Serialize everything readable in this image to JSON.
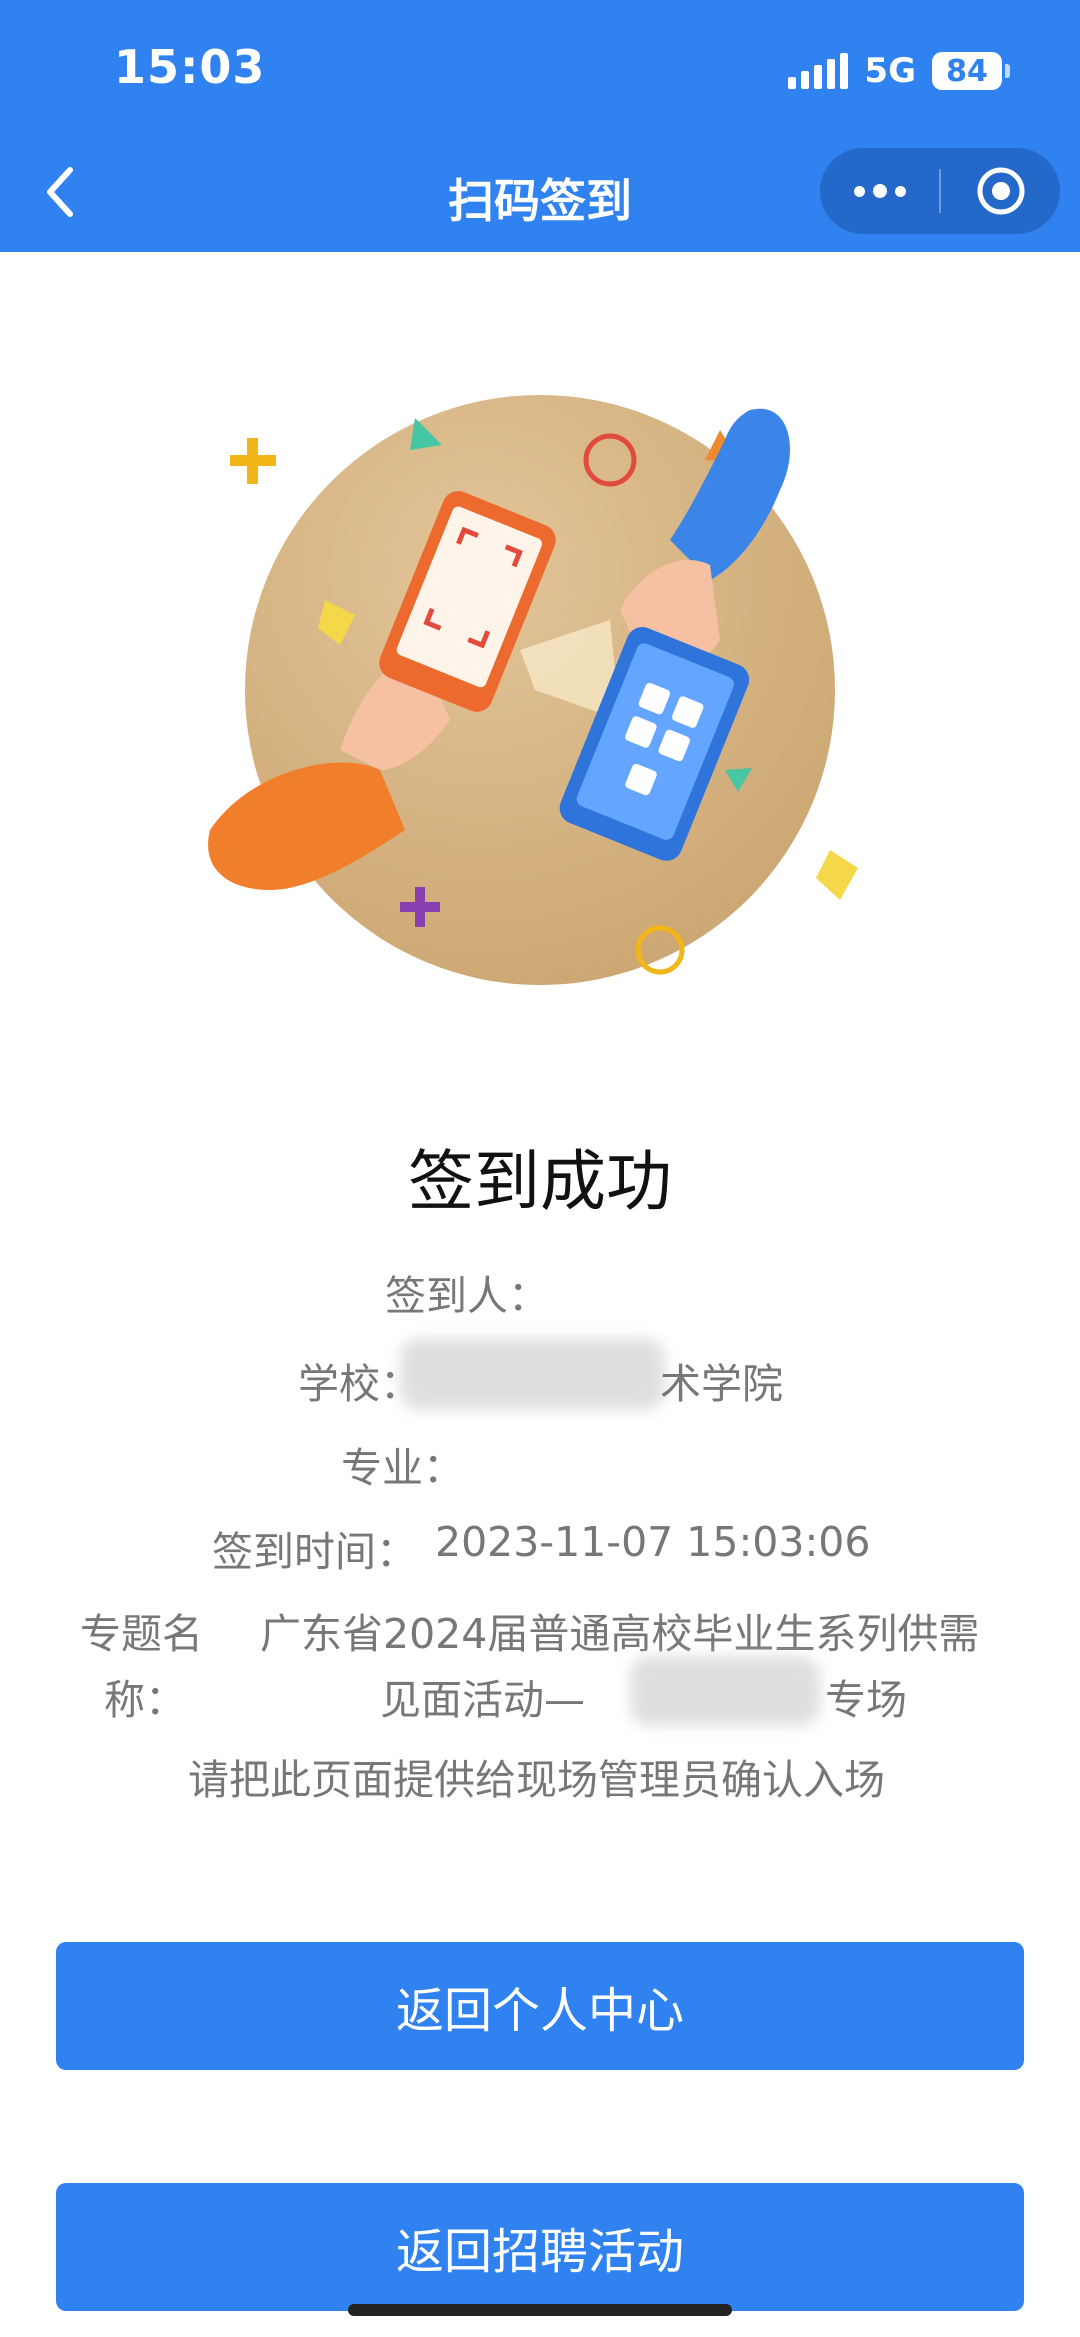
{
  "status_bar": {
    "time": "15:03",
    "network": "5G",
    "battery": "84"
  },
  "nav": {
    "title": "扫码签到"
  },
  "icons": [
    "back-arrow-icon",
    "more-icon",
    "close-target-icon"
  ],
  "colors": {
    "primary": "#2f82f0",
    "capsule": "#2468c9",
    "text_gray": "#777777"
  },
  "result": {
    "title": "签到成功",
    "signer_label": "签到人：",
    "school_label": "学校：",
    "school_value_visible": "术学院",
    "major_label": "专业：",
    "time_label": "签到时间：",
    "time_value": "2023-11-07 15:03:06",
    "topic_label_line1": "专题名",
    "topic_label_line2": "称：",
    "topic_value_line1": "广东省2024届普通高校毕业生系列供需",
    "topic_value_line2_prefix": "见面活动—",
    "topic_value_line2_suffix": "专场",
    "note": "请把此页面提供给现场管理员确认入场"
  },
  "buttons": {
    "personal_center": "返回个人中心",
    "recruit_activity": "返回招聘活动"
  }
}
